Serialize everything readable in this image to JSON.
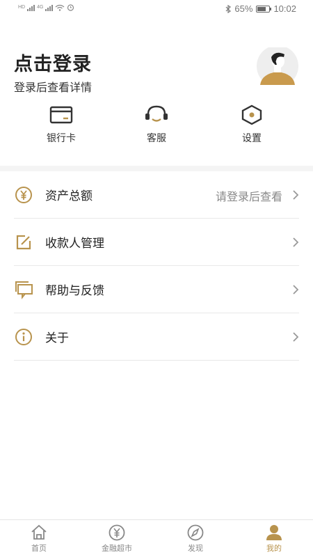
{
  "status_bar": {
    "left_badges": [
      "HD",
      "4G",
      "4G"
    ],
    "bluetooth_icon": "bluetooth-icon",
    "battery_percent": "65%",
    "time": "10:02"
  },
  "header": {
    "title": "点击登录",
    "subtitle": "登录后查看详情",
    "avatar_icon": "user-avatar-icon"
  },
  "quick_actions": [
    {
      "label": "银行卡",
      "icon": "bank-card-icon"
    },
    {
      "label": "客服",
      "icon": "headset-icon"
    },
    {
      "label": "设置",
      "icon": "settings-hexagon-icon"
    }
  ],
  "menu": [
    {
      "label": "资产总额",
      "hint": "请登录后查看",
      "icon": "yen-circle-icon"
    },
    {
      "label": "收款人管理",
      "hint": "",
      "icon": "edit-icon"
    },
    {
      "label": "帮助与反馈",
      "hint": "",
      "icon": "chat-bubbles-icon"
    },
    {
      "label": "关于",
      "hint": "",
      "icon": "info-icon"
    }
  ],
  "tab_bar": [
    {
      "label": "首页",
      "icon": "home-icon"
    },
    {
      "label": "金融超市",
      "icon": "yen-circle-icon"
    },
    {
      "label": "发现",
      "icon": "compass-icon"
    },
    {
      "label": "我的",
      "icon": "person-icon"
    }
  ],
  "colors": {
    "accent": "#b8934d",
    "icon_dark": "#333333",
    "divider": "#e8e8e8"
  }
}
